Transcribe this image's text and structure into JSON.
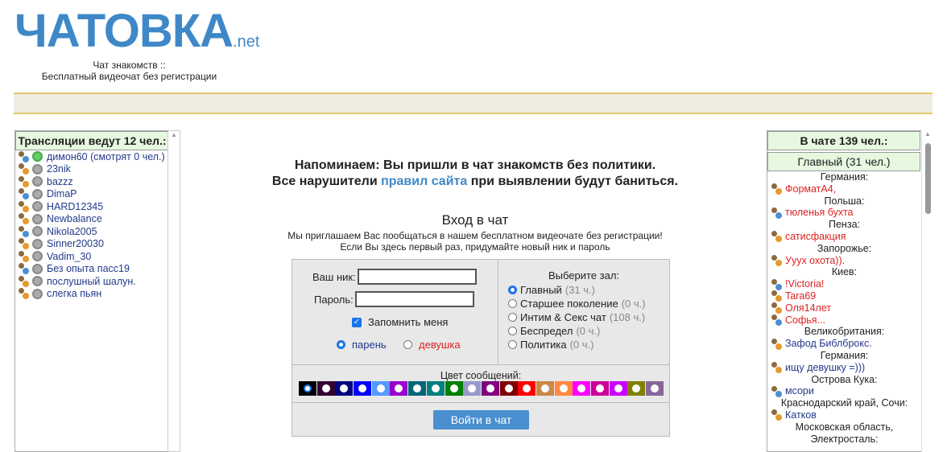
{
  "header": {
    "logo": "ЧАТОВКА",
    "logo_suffix": ".net",
    "tagline1": "Чат знакомств ::",
    "tagline2": "Бесплатный видеочат без регистрации"
  },
  "broadcasts": {
    "title": "Трансляции ведут 12 чел.:",
    "items": [
      {
        "name": "димон60 (смотрят 0 чел.)",
        "active": true
      },
      {
        "name": "23nik"
      },
      {
        "name": "bazzz"
      },
      {
        "name": "DimaP"
      },
      {
        "name": "HARD12345"
      },
      {
        "name": "Newbalance"
      },
      {
        "name": "Nikola2005"
      },
      {
        "name": "Sinner20030"
      },
      {
        "name": "Vadim_30"
      },
      {
        "name": "Без опыта пасс19"
      },
      {
        "name": "послушный шалун."
      },
      {
        "name": "слегка пьян"
      }
    ]
  },
  "notice": {
    "line1": "Напоминаем: Вы пришли в чат знакомств без политики.",
    "line2_pre": "Все нарушители ",
    "line2_link": "правил сайта",
    "line2_post": " при выявлении будут баниться."
  },
  "login": {
    "title": "Вход в чат",
    "sub1": "Мы приглашаем Вас пообщаться в нашем бесплатном видеочате без регистрации!",
    "sub2": "Если Вы здесь первый раз, придумайте новый ник и пароль",
    "nick_label": "Ваш ник:",
    "nick_value": "",
    "password_label": "Пароль:",
    "password_value": "",
    "remember": "Запомнить меня",
    "remember_checked": true,
    "male": "парень",
    "female": "девушка",
    "gender": "male",
    "hall_label": "Выберите зал:",
    "halls": [
      {
        "name": "Главный",
        "count": "(31 ч.)",
        "selected": true
      },
      {
        "name": "Старшее поколение",
        "count": "(0 ч.)"
      },
      {
        "name": "Интим & Секс чат",
        "count": "(108 ч.)"
      },
      {
        "name": "Беспредел",
        "count": "(0 ч.)"
      },
      {
        "name": "Политика",
        "count": "(0 ч.)"
      }
    ],
    "color_label": "Цвет сообщений:",
    "colors": [
      "#000000",
      "#330033",
      "#000080",
      "#0000ff",
      "#5599ff",
      "#9900cc",
      "#006677",
      "#008080",
      "#008000",
      "#9999cc",
      "#800080",
      "#800000",
      "#ff0000",
      "#cc8844",
      "#ff8844",
      "#ff00ff",
      "#cc0099",
      "#cc00ff",
      "#808000",
      "#886699"
    ],
    "submit": "Войти в чат"
  },
  "online": {
    "title": "В чате 139 чел.:",
    "room": "Главный (31 чел.)",
    "groups": [
      {
        "city": "Германия:",
        "users": [
          {
            "n": "ФорматА4,",
            "g": "f"
          }
        ]
      },
      {
        "city": "Польша:",
        "users": [
          {
            "n": "тюленья бухта",
            "g": "f"
          }
        ]
      },
      {
        "city": "Пенза:",
        "users": [
          {
            "n": "сатисфакция",
            "g": "f"
          }
        ]
      },
      {
        "city": "Запорожье:",
        "users": [
          {
            "n": "Уууx охота)).",
            "g": "f"
          }
        ]
      },
      {
        "city": "Киев:",
        "users": [
          {
            "n": "!Victoria!",
            "g": "f"
          },
          {
            "n": "Tara69",
            "g": "f"
          },
          {
            "n": "Оля14лет",
            "g": "f"
          },
          {
            "n": "Софья...",
            "g": "f"
          }
        ]
      },
      {
        "city": "Великобритания:",
        "users": [
          {
            "n": "Зафод Библброкс.",
            "g": "m"
          }
        ]
      },
      {
        "city": "Германия:",
        "users": [
          {
            "n": "ищу девушку =)))",
            "g": "m"
          }
        ]
      },
      {
        "city": "Острова Кука:",
        "users": [
          {
            "n": "мсори",
            "g": "m"
          }
        ]
      },
      {
        "city": "Краснодарский край, Сочи:",
        "users": [
          {
            "n": "Катков",
            "g": "m"
          }
        ]
      },
      {
        "city": "Московская область, Электросталь:",
        "users": []
      }
    ]
  }
}
